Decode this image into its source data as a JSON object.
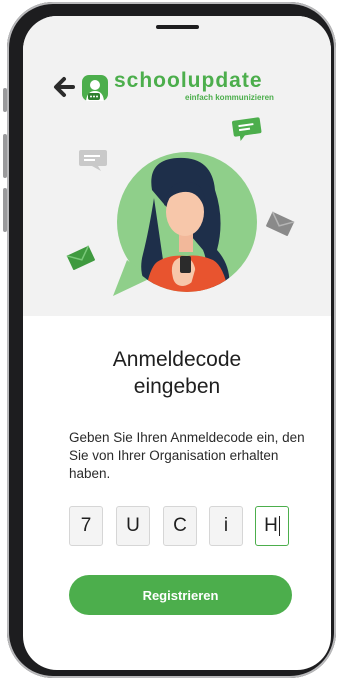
{
  "header": {
    "brand_name": "schoolupdate",
    "tagline": "einfach kommunizieren"
  },
  "main": {
    "title_line1": "Anmeldecode",
    "title_line2": "eingeben",
    "description": "Geben Sie Ihren Anmeldecode ein, den Sie von Ihrer Organisation erhalten haben.",
    "code": [
      "7",
      "U",
      "C",
      "i",
      "H"
    ],
    "register_label": "Registrieren"
  },
  "colors": {
    "brand": "#4cae4c",
    "header_bg": "#f2f2f2",
    "phone_frame": "#1d1d1f"
  },
  "icons": [
    "back-arrow-icon",
    "schoolupdate-logo-icon",
    "chat-bubble-icon",
    "envelope-icon"
  ]
}
